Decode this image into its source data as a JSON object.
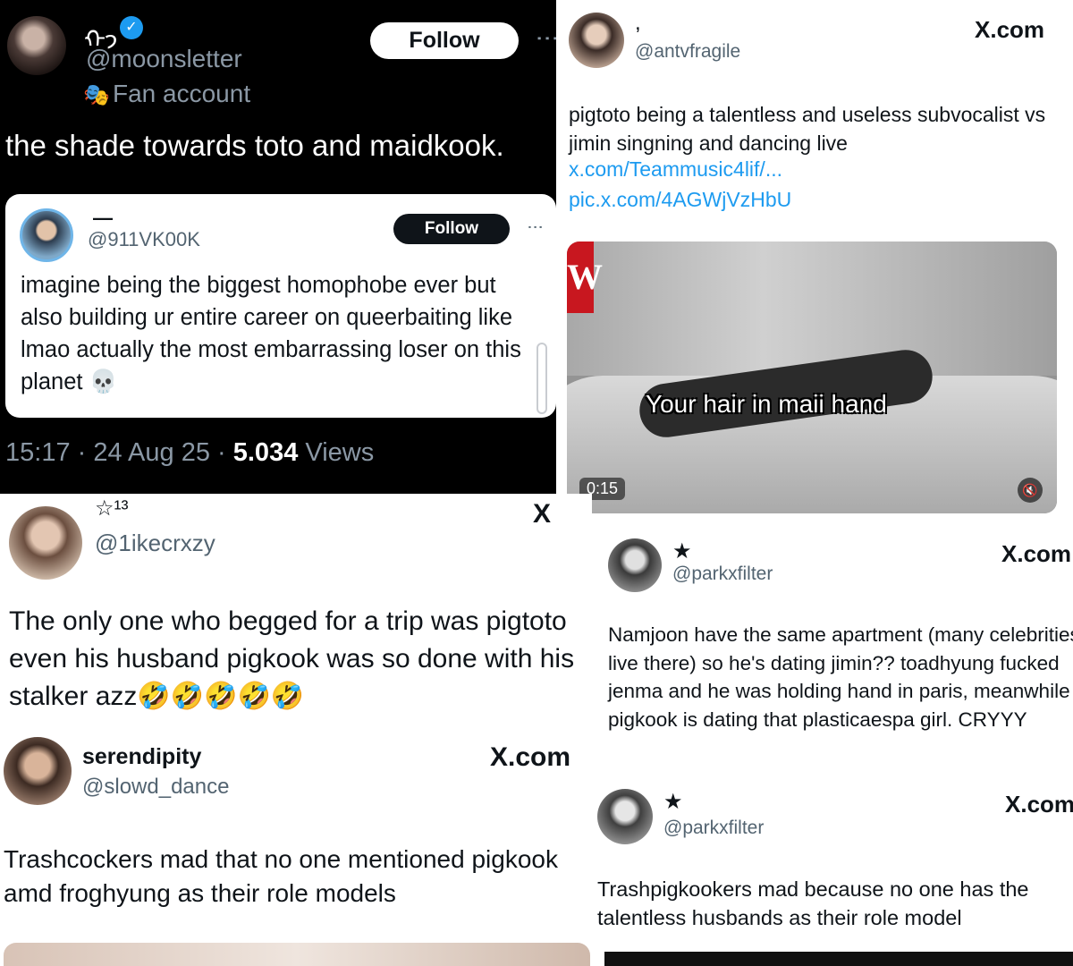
{
  "colors": {
    "accent": "#1d9bf0",
    "dark_bg": "#000000",
    "muted": "#536471"
  },
  "panel1": {
    "display_name": "ᡣ𐭩",
    "verified": "✓",
    "handle": "@moonsletter",
    "fan_icon": "🎭",
    "fan_label": "Fan account",
    "follow_label": "Follow",
    "more": "⋮",
    "text": "the shade towards toto and maidkook.",
    "quote": {
      "display_name": "—",
      "handle": "@911VK00K",
      "follow_label": "Follow",
      "more": "⋮",
      "text": "imagine being the biggest homophobe ever but also building ur entire career on queerbaiting like lmao actually the most embarrassing loser on this planet 💀"
    },
    "time": "15:17 · 24 Aug 25 · ",
    "views_count": "5.034",
    "views_label": " Views"
  },
  "panel2": {
    "display_name": ",",
    "handle": "@antvfragile",
    "site": "X.com",
    "text": "pigtoto being a talentless and useless subvocalist vs jimin singning and dancing live",
    "link1": "x.com/Teammusic4lif/...",
    "link2": "pic.x.com/4AGWjVzHbU",
    "video": {
      "brand_letter": "W",
      "caption": "Your hair in maii hand",
      "duration": "0:15",
      "mute_icon": "🔇"
    }
  },
  "panel3": {
    "display_name": "☆¹³",
    "handle": "@1ikecrxzy",
    "site": "X",
    "text": "The only one who begged for a trip was pigtoto even his husband pigkook was so done with his stalker azz🤣🤣🤣🤣🤣"
  },
  "panel4": {
    "display_name": "serendipity",
    "handle": "@slowd_dance",
    "site": "X.com",
    "text": "Trashcockers mad that no one mentioned pigkook amd froghyung as their role models"
  },
  "panel5": {
    "display_name": "★",
    "handle": "@parkxfilter",
    "site": "X.com",
    "text": "Namjoon have the same apartment (many celebrities live there) so he's dating jimin?? toadhyung fucked jenma and he was holding hand in paris, meanwhile pigkook is dating that plasticaespa girl. CRYYY"
  },
  "panel6": {
    "display_name": "★",
    "handle": "@parkxfilter",
    "site": "X.com",
    "text": "Trashpigkookers mad because no one has the talentless husbands as their role model"
  }
}
